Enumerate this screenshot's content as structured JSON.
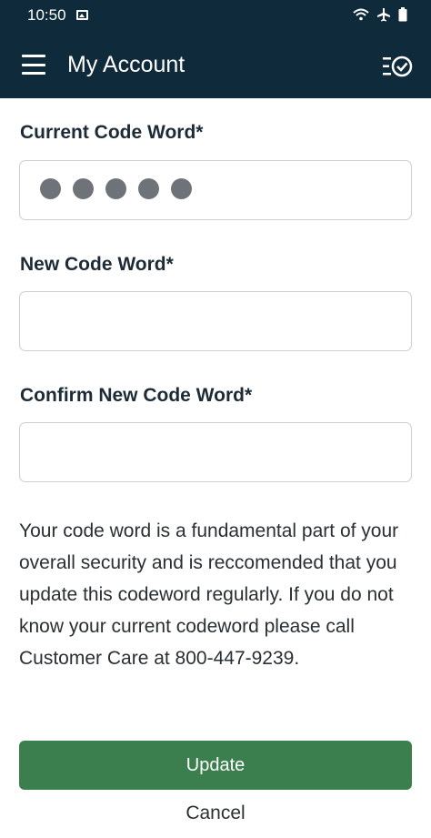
{
  "status_bar": {
    "time": "10:50",
    "icons": [
      "image-icon",
      "wifi-icon",
      "airplane-icon",
      "battery-icon"
    ]
  },
  "app_bar": {
    "title": "My Account",
    "menu_icon": "hamburger-menu-icon",
    "action_icon": "checklist-icon"
  },
  "form": {
    "current_code_word": {
      "label": "Current Code Word*",
      "masked_chars": 5
    },
    "new_code_word": {
      "label": "New Code Word*",
      "value": ""
    },
    "confirm_new_code_word": {
      "label": "Confirm New Code Word*",
      "value": ""
    }
  },
  "info_text": "Your code word is a fundamental part of your overall security and is reccomended that you update this codeword regularly. If you do not know your current codeword please call Customer Care at 800-447-9239.",
  "actions": {
    "update_label": "Update",
    "cancel_label": "Cancel"
  },
  "colors": {
    "header_bg": "#0f2a3a",
    "button_bg": "#3b7f4e",
    "text": "#1d2b36"
  }
}
